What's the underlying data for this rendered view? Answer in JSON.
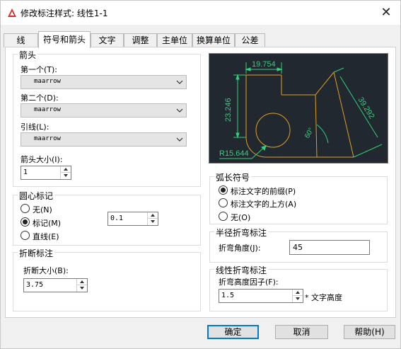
{
  "window": {
    "title": "修改标注样式: 线性1-1",
    "close_glyph": "✕"
  },
  "tabs": [
    {
      "label": "线",
      "active": false
    },
    {
      "label": "符号和箭头",
      "active": true
    },
    {
      "label": "文字",
      "active": false
    },
    {
      "label": "调整",
      "active": false
    },
    {
      "label": "主单位",
      "active": false
    },
    {
      "label": "换算单位",
      "active": false
    },
    {
      "label": "公差",
      "active": false
    }
  ],
  "arrowheads": {
    "title": "箭头",
    "first_label": "第一个(T):",
    "first_value": "maarrow",
    "second_label": "第二个(D):",
    "second_value": "maarrow",
    "leader_label": "引线(L):",
    "leader_value": "maarrow",
    "size_label": "箭头大小(I):",
    "size_value": "1"
  },
  "center_marks": {
    "title": "圆心标记",
    "options": [
      {
        "label": "无(N)",
        "checked": false
      },
      {
        "label": "标记(M)",
        "checked": true
      },
      {
        "label": "直线(E)",
        "checked": false
      }
    ],
    "size_value": "0.1"
  },
  "dimension_break": {
    "title": "折断标注",
    "size_label": "折断大小(B):",
    "size_value": "3.75"
  },
  "arc_length_symbol": {
    "title": "弧长符号",
    "options": [
      {
        "label": "标注文字的前缀(P)",
        "checked": true
      },
      {
        "label": "标注文字的上方(A)",
        "checked": false
      },
      {
        "label": "无(O)",
        "checked": false
      }
    ]
  },
  "radius_jog": {
    "title": "半径折弯标注",
    "angle_label": "折弯角度(J):",
    "angle_value": "45"
  },
  "linear_jog": {
    "title": "线性折弯标注",
    "factor_label": "折弯高度因子(F):",
    "factor_value": "1.5",
    "suffix": "* 文字高度"
  },
  "preview": {
    "dim_top": "19.754",
    "dim_left": "23.246",
    "dim_right": "39.292",
    "dim_angle": "60°",
    "dim_radius": "R15.644",
    "colors": {
      "background": "#212830",
      "geometry": "#e0a020",
      "dimension": "#33d17a"
    }
  },
  "buttons": {
    "ok": "确定",
    "cancel": "取消",
    "help": "帮助(H)"
  }
}
